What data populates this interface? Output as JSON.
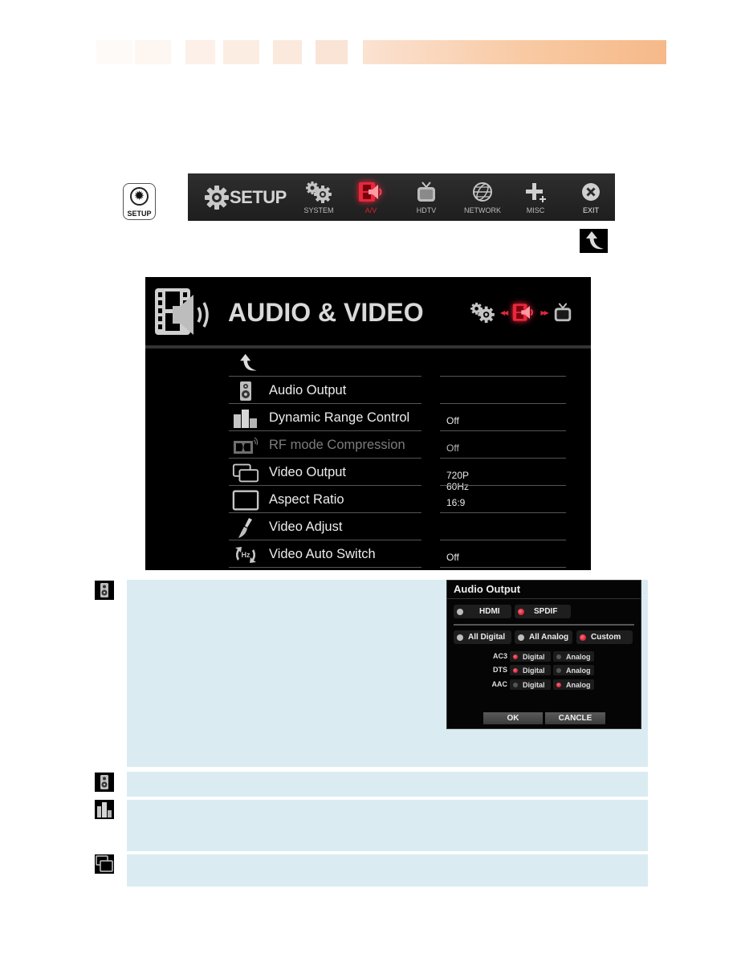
{
  "header": {
    "blocks": [
      "#fefaf7",
      "#fdf6f1",
      "#fdf3ec",
      "#fcefe6",
      "#fbebe0",
      "#fae6d9"
    ],
    "bar_color_start": "#fbe2d2",
    "bar_color_end": "#f6b989"
  },
  "remote_button": {
    "icon": "gear-icon",
    "label": "SETUP"
  },
  "setup_menu": {
    "title": "SETUP",
    "accent_color": "#e01e2e",
    "items": [
      {
        "label": "SYSTEM",
        "icon": "gears-icon",
        "active": false
      },
      {
        "label": "A/V",
        "icon": "av-icon",
        "active": true
      },
      {
        "label": "HDTV",
        "icon": "tv-icon",
        "active": false
      },
      {
        "label": "NETWORK",
        "icon": "globe-icon",
        "active": false
      },
      {
        "label": "MISC",
        "icon": "plus-icon",
        "active": false
      },
      {
        "label": "EXIT",
        "icon": "close-circle-icon",
        "active": false
      }
    ]
  },
  "return_icon": "return-arrow-icon",
  "av_panel": {
    "title": "AUDIO & VIDEO",
    "nav": {
      "prev": "gears-icon",
      "current": "av-icon",
      "next": "tv-icon"
    },
    "rows": [
      {
        "label": "Audio Output",
        "value": "",
        "icon": "speaker-icon",
        "dimmed": false
      },
      {
        "label": "Dynamic Range Control",
        "value": "Off",
        "icon": "equalizer-icon",
        "dimmed": false
      },
      {
        "label": "RF mode Compression",
        "value": "Off",
        "icon": "dolby-icon",
        "dimmed": true
      },
      {
        "label": "Video Output",
        "value": "720P 60Hz",
        "icon": "dual-screen-icon",
        "dimmed": false
      },
      {
        "label": "Aspect Ratio",
        "value": "16:9",
        "icon": "screen-icon",
        "dimmed": false
      },
      {
        "label": "Video Adjust",
        "value": "",
        "icon": "brush-icon",
        "dimmed": false
      },
      {
        "label": "Video Auto Switch",
        "value": "Off",
        "icon": "hz-switch-icon",
        "dimmed": false
      }
    ]
  },
  "explanations": [
    {
      "icon": "speaker-icon"
    },
    {
      "icon": "speaker-icon"
    },
    {
      "icon": "equalizer-icon"
    },
    {
      "icon": "dual-screen-icon"
    }
  ],
  "audio_output_dialog": {
    "title": "Audio Output",
    "outputs": [
      {
        "label": "HDMI",
        "selected": false
      },
      {
        "label": "SPDIF",
        "selected": true
      }
    ],
    "modes": [
      {
        "label": "All Digital",
        "selected": false
      },
      {
        "label": "All Analog",
        "selected": false
      },
      {
        "label": "Custom",
        "selected": true
      }
    ],
    "codecs": [
      {
        "name": "AC3",
        "digital_label": "Digital",
        "analog_label": "Analog",
        "selected": "Digital"
      },
      {
        "name": "DTS",
        "digital_label": "Digital",
        "analog_label": "Analog",
        "selected": "Digital"
      },
      {
        "name": "AAC",
        "digital_label": "Digital",
        "analog_label": "Analog",
        "selected": "Analog"
      }
    ],
    "ok_label": "OK",
    "cancel_label": "CANCLE"
  }
}
